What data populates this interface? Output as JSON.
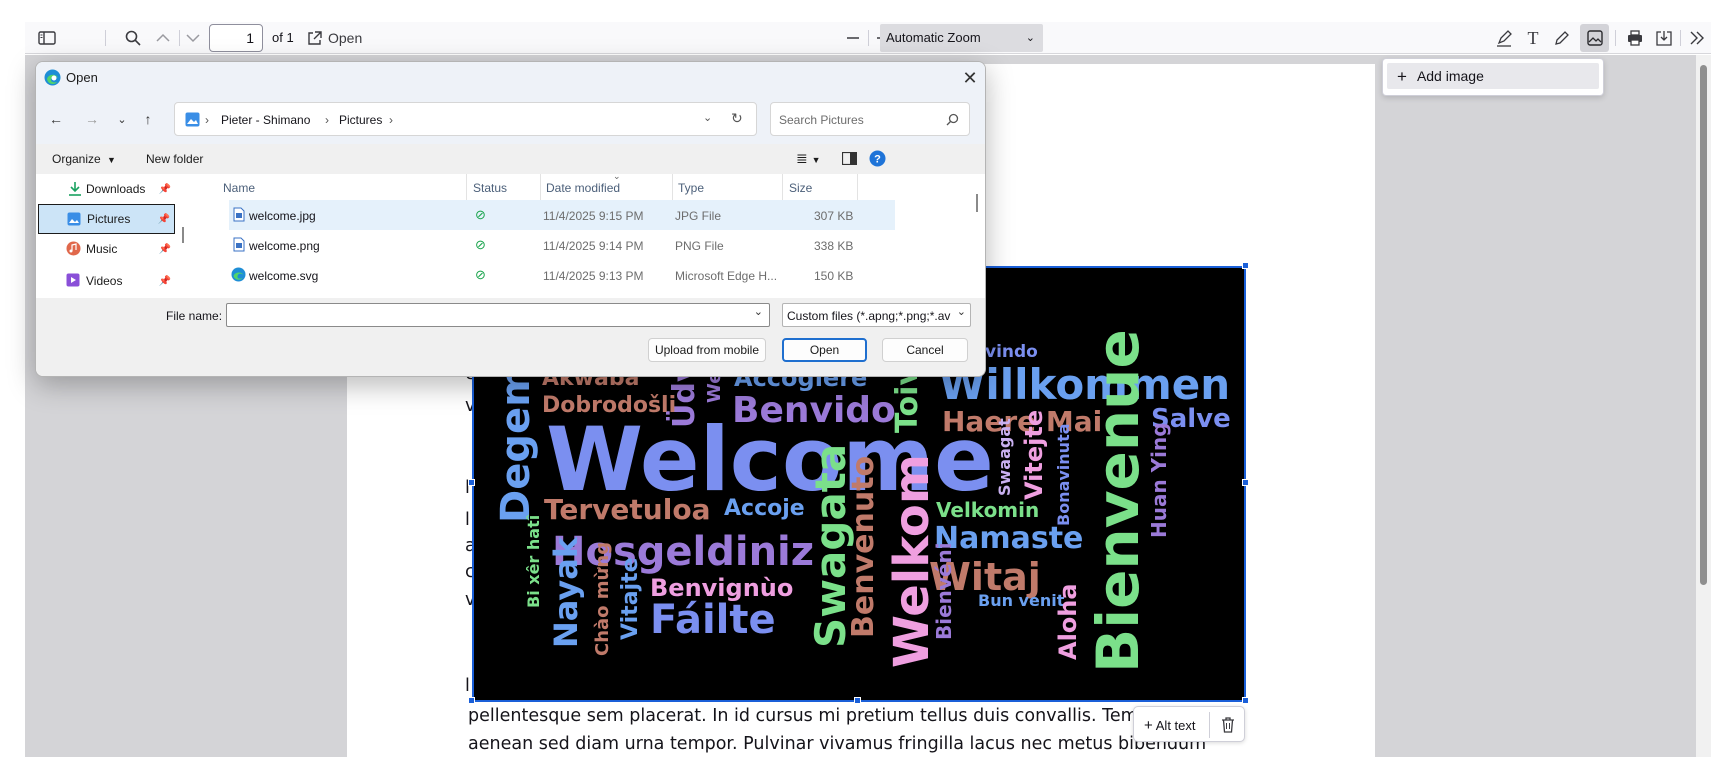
{
  "toolbar": {
    "page_number": "1",
    "page_count": "of 1",
    "open_label": "Open",
    "zoom_value": "Automatic Zoom"
  },
  "add_image_popup": {
    "label": "Add image"
  },
  "pdf": {
    "line1": "pellentesque sem placerat. In id cursus mi pretium tellus duis convallis. Temp",
    "line2": "aenean sed diam urna tempor. Pulvinar vivamus fringilla lacus nec metus bibendum",
    "margin_letters": [
      "c",
      "v",
      "l",
      "l",
      "a",
      "c",
      "v",
      "l"
    ]
  },
  "stamp": {
    "alt_text_label": "Alt text",
    "words": [
      {
        "t": "vindo",
        "c": "#7b8ff0"
      },
      {
        "t": "Akwaba",
        "c": "#c07a6a"
      },
      {
        "t": "Üdv",
        "c": "#9b7ad8"
      },
      {
        "t": "We",
        "c": "#9b7ad8"
      },
      {
        "t": "Accoglere",
        "c": "#6aa0f0"
      },
      {
        "t": "Willkommen",
        "c": "#6aa0f0"
      },
      {
        "t": "Dobrodošli",
        "c": "#c07a6a"
      },
      {
        "t": "Benvido",
        "c": "#9b7ad8"
      },
      {
        "t": "Toivo",
        "c": "#7be08a"
      },
      {
        "t": "Haere Mai",
        "c": "#c07a6a"
      },
      {
        "t": "Salve",
        "c": "#7b8ff0"
      },
      {
        "t": "Degeme",
        "c": "#6aa0f0"
      },
      {
        "t": "Welcome",
        "c": "#7b8ff0"
      },
      {
        "t": "Swaagat",
        "c": "#c9b0f0"
      },
      {
        "t": "Vitejte",
        "c": "#ef9fe0"
      },
      {
        "t": "Bonavinuta",
        "c": "#7b8ff0"
      },
      {
        "t": "Bienvenue",
        "c": "#7be08a"
      },
      {
        "t": "Huan Ying",
        "c": "#9b7ad8"
      },
      {
        "t": "Tervetuloa",
        "c": "#c07a6a"
      },
      {
        "t": "Accoje",
        "c": "#6aa0f0"
      },
      {
        "t": "Velkomin",
        "c": "#7be08a"
      },
      {
        "t": "Namaste",
        "c": "#6aa0f0"
      },
      {
        "t": "Hosgeldiniz",
        "c": "#9b7ad8"
      },
      {
        "t": "Swagata",
        "c": "#7be08a"
      },
      {
        "t": "Benvenuto",
        "c": "#c07a6a"
      },
      {
        "t": "Welkom",
        "c": "#ef9fe0"
      },
      {
        "t": "Witaj",
        "c": "#c07a6a"
      },
      {
        "t": "Bienvéni",
        "c": "#9b7ad8"
      },
      {
        "t": "Bi xêr hatî",
        "c": "#7be08a"
      },
      {
        "t": "Nayak",
        "c": "#6aa0f0"
      },
      {
        "t": "Benvignùo",
        "c": "#ef9fe0"
      },
      {
        "t": "Chào mừng",
        "c": "#c07a6a"
      },
      {
        "t": "Vitajte",
        "c": "#6aa0f0"
      },
      {
        "t": "Fáilte",
        "c": "#7b8ff0"
      },
      {
        "t": "Bun venit",
        "c": "#6aa0f0"
      },
      {
        "t": "Aloha",
        "c": "#ef9fe0"
      }
    ]
  },
  "dialog": {
    "title": "Open",
    "breadcrumb": [
      "Pieter - Shimano",
      "Pictures"
    ],
    "search_placeholder": "Search Pictures",
    "organize_label": "Organize",
    "new_folder_label": "New folder",
    "nav_items": [
      {
        "label": "Downloads",
        "icon": "download-icon"
      },
      {
        "label": "Pictures",
        "icon": "pictures-icon"
      },
      {
        "label": "Music",
        "icon": "music-icon"
      },
      {
        "label": "Videos",
        "icon": "videos-icon"
      }
    ],
    "columns": [
      "Name",
      "Status",
      "Date modified",
      "Type",
      "Size"
    ],
    "files": [
      {
        "name": "welcome.jpg",
        "date": "11/4/2025 9:15 PM",
        "type": "JPG File",
        "size": "307 KB"
      },
      {
        "name": "welcome.png",
        "date": "11/4/2025 9:14 PM",
        "type": "PNG File",
        "size": "338 KB"
      },
      {
        "name": "welcome.svg",
        "date": "11/4/2025 9:13 PM",
        "type": "Microsoft Edge H...",
        "size": "150 KB"
      }
    ],
    "file_name_label": "File name:",
    "file_name_value": "",
    "file_type_value": "Custom files (*.apng;*.png;*.av",
    "upload_label": "Upload from mobile",
    "open_label": "Open",
    "cancel_label": "Cancel"
  }
}
